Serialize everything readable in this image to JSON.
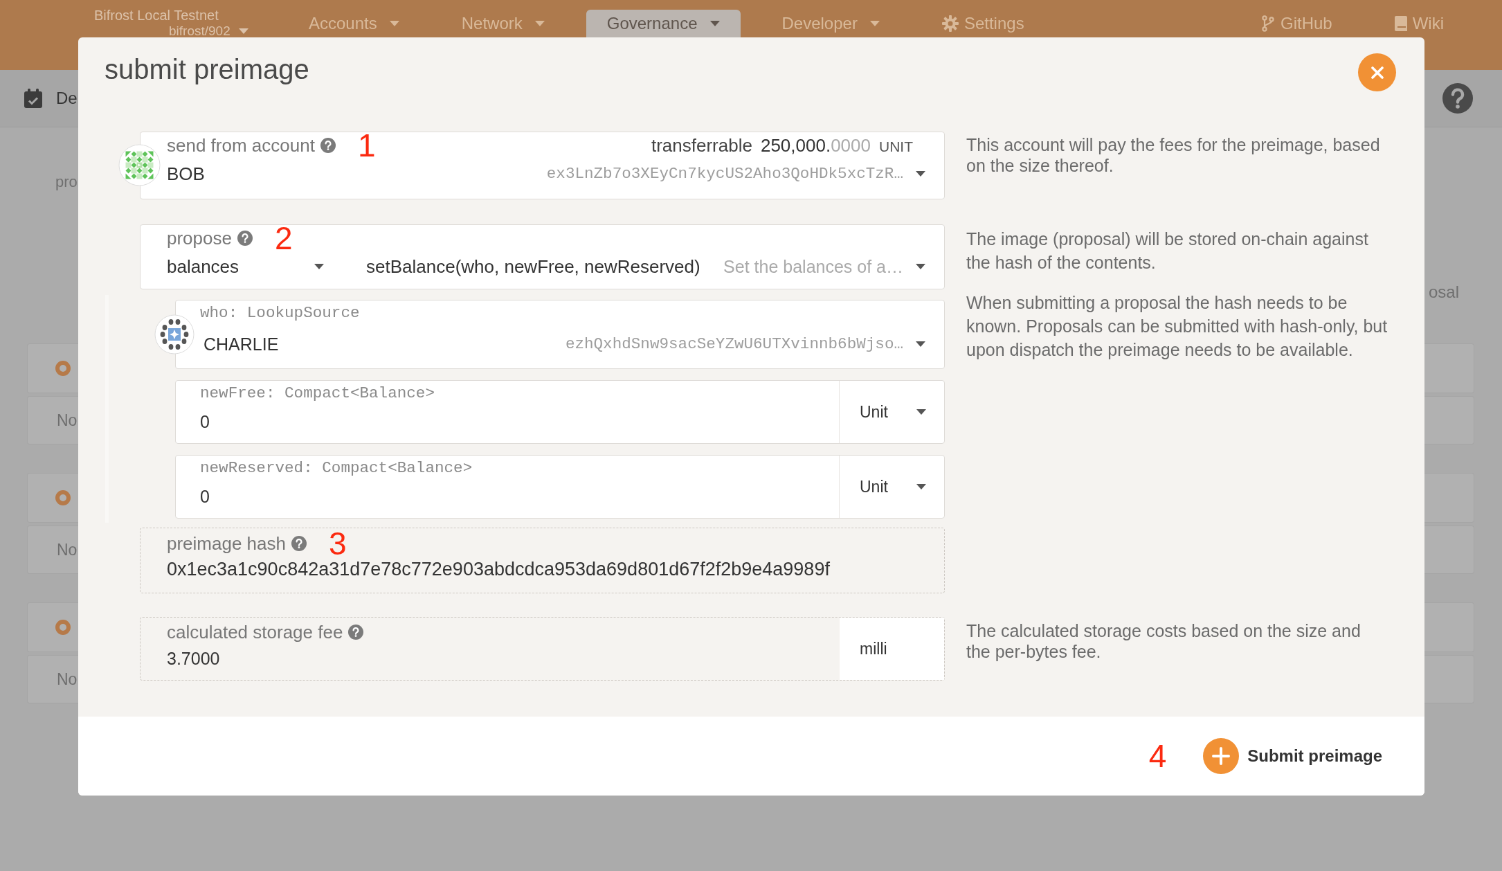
{
  "top_bar": {
    "chain_name": "Bifrost Local Testnet",
    "node": "bifrost/902",
    "nav": [
      {
        "label": "Accounts",
        "kind": "menu",
        "selected": false
      },
      {
        "label": "Network",
        "kind": "menu",
        "selected": false
      },
      {
        "label": "Governance",
        "kind": "menu",
        "selected": true
      },
      {
        "label": "Developer",
        "kind": "menu",
        "selected": false
      },
      {
        "label": "Settings",
        "kind": "settings",
        "selected": false
      },
      {
        "label": "GitHub",
        "kind": "repository",
        "selected": false
      },
      {
        "label": "Wiki",
        "kind": "wiki",
        "selected": false
      }
    ]
  },
  "sub_bar": {
    "section": "De"
  },
  "page": {
    "left_text": "pro",
    "right_text": "osal",
    "cards": [
      {
        "text": "No"
      },
      {
        "text": "No"
      },
      {
        "text": "No"
      }
    ]
  },
  "dialog": {
    "title": "submit preimage",
    "account": {
      "label": "send from account",
      "marker": "1",
      "balance_label": "transferrable",
      "balance": "250,000.0000",
      "unit": "UNIT",
      "name": "BOB",
      "address": "ex3LnZb7o3XEyCn7kycUS2Aho3QoHDk5xcTzR…",
      "help": "This account will pay the fees for the preimage, based on the size thereof."
    },
    "proposal": {
      "label": "propose",
      "marker": "2",
      "module": "balances",
      "method": "setBalance(who, newFree, newReserved)",
      "description": "Set the balances of a…",
      "params": [
        {
          "kind": "account",
          "label": "who: LookupSource",
          "name": "CHARLIE",
          "address": "ezhQxhdSnw9sacSeYZwU6UTXvinnb6bWjso…"
        },
        {
          "kind": "balance",
          "label": "newFree: Compact<Balance>",
          "value": "0",
          "unit": "Unit"
        },
        {
          "kind": "balance",
          "label": "newReserved: Compact<Balance>",
          "value": "0",
          "unit": "Unit"
        }
      ],
      "help": [
        "The image (proposal) will be stored on-chain against the hash of the contents.",
        "When submitting a proposal the hash needs to be known. Proposals can be submitted with hash-only, but upon dispatch the preimage needs to be available."
      ]
    },
    "hash": {
      "label": "preimage hash",
      "marker": "3",
      "value": "0x1ec3a1c90c842a31d7e78c772e903abdcdca953da69d801d67f2f2b9e4a9989f"
    },
    "fee": {
      "label": "calculated storage fee",
      "value": "3.7000",
      "unit": "milli",
      "help": "The calculated storage costs based on the size and the per-bytes fee."
    },
    "footer": {
      "marker": "4",
      "submit": "Submit preimage"
    }
  }
}
